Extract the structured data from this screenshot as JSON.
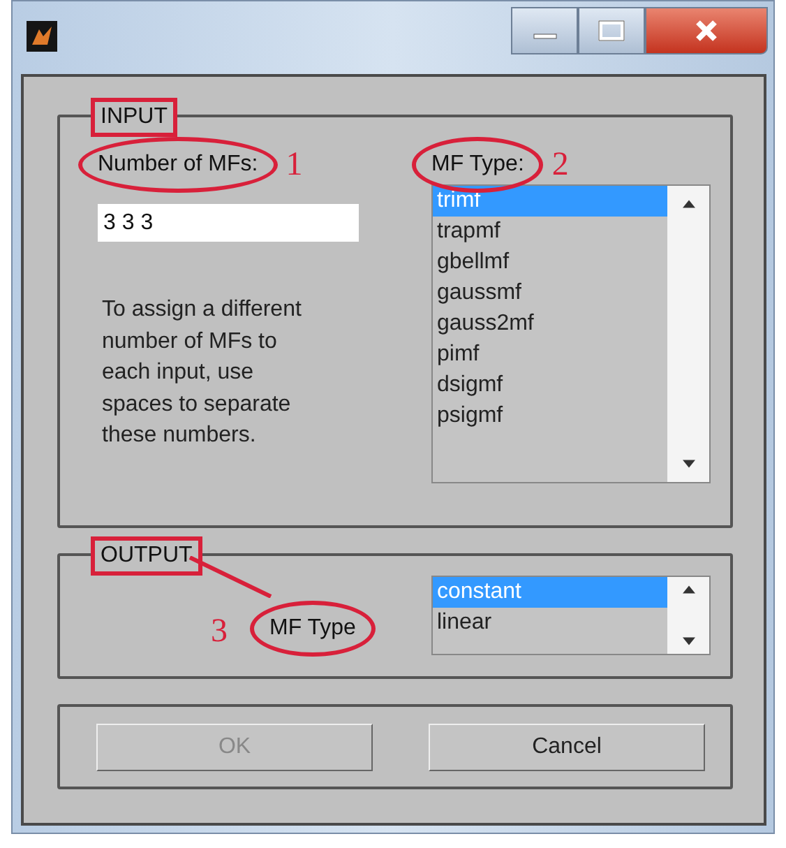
{
  "input_panel": {
    "title": {
      "text": "INPUT",
      "boxed": true
    },
    "number_label": {
      "text": "Number of MFs:",
      "circled": true,
      "note": "1"
    },
    "number_field": {
      "value": "3 3 3"
    },
    "help_text": "To assign a different number of MFs to each input, use spaces to separate these numbers.",
    "mf_type_label": {
      "text": "MF Type:",
      "circled": true,
      "note": "2"
    },
    "mf_types": [
      {
        "label": "trimf",
        "selected": true
      },
      {
        "label": "trapmf",
        "selected": false
      },
      {
        "label": "gbellmf",
        "selected": false
      },
      {
        "label": "gaussmf",
        "selected": false
      },
      {
        "label": "gauss2mf",
        "selected": false
      },
      {
        "label": "pimf",
        "selected": false
      },
      {
        "label": "dsigmf",
        "selected": false
      },
      {
        "label": "psigmf",
        "selected": false
      }
    ]
  },
  "output_panel": {
    "title": {
      "text": "OUTPUT",
      "boxed": true
    },
    "mf_type_label": {
      "text": "MF Type",
      "circled": true,
      "note": "3"
    },
    "mf_types": [
      {
        "label": "constant",
        "selected": true
      },
      {
        "label": "linear",
        "selected": false
      }
    ]
  },
  "buttons": [
    {
      "label": "OK",
      "disabled": true
    },
    {
      "label": "Cancel",
      "disabled": false
    }
  ]
}
